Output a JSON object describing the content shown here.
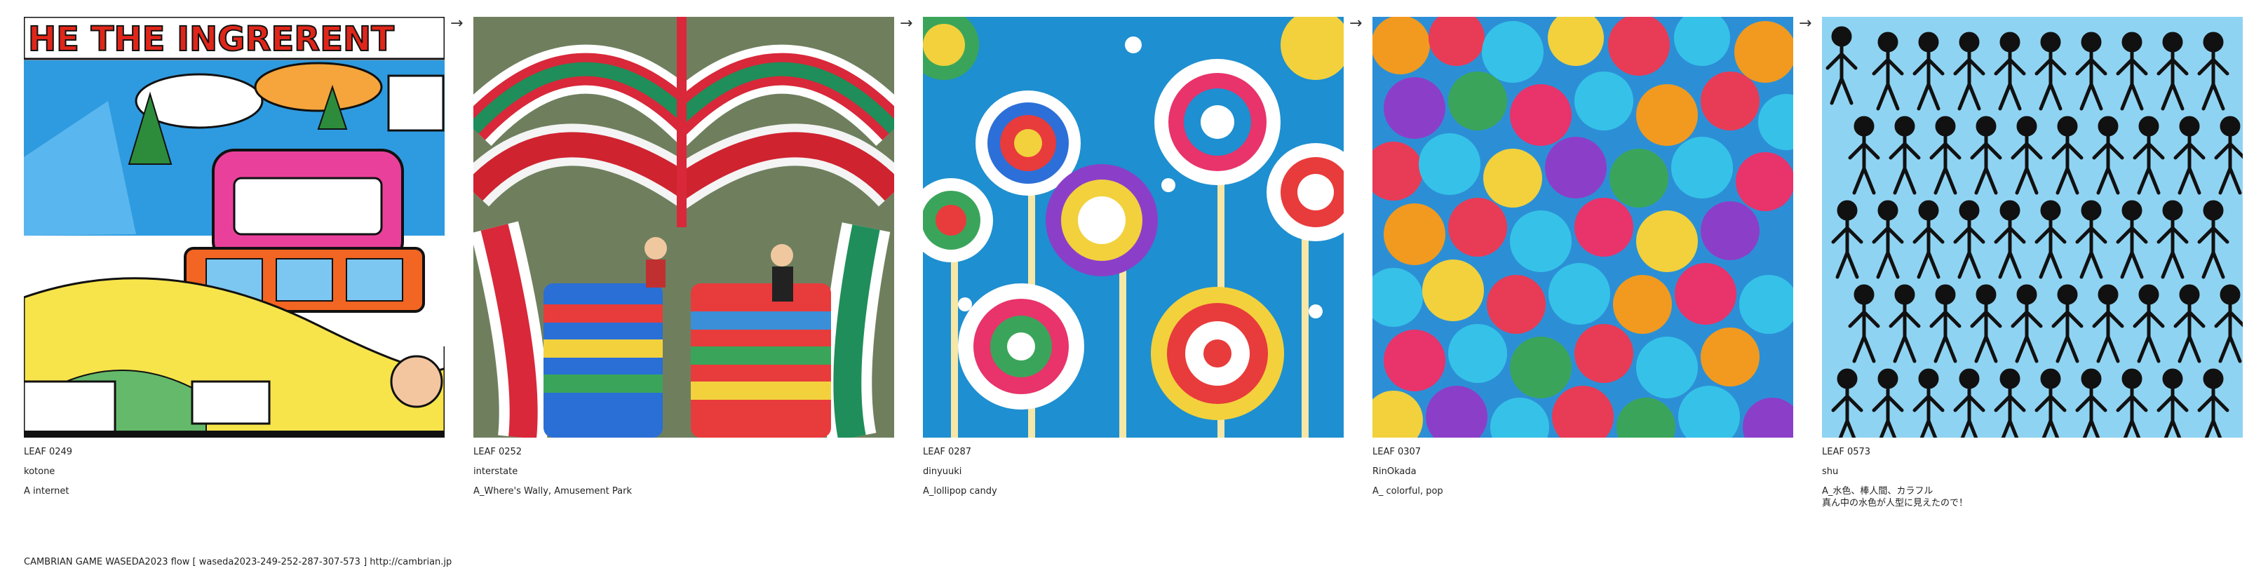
{
  "footer": {
    "text": "CAMBRIAN GAME  WASEDA2023  flow [ waseda2023-249-252-287-307-573 ]    http://cambrian.jp"
  },
  "flow": {
    "arrow_glyph": "→",
    "leaves": [
      {
        "id": "LEAF 0249",
        "author": "kotone",
        "prompt": "A internet",
        "image": "comic-style cartoon illustration with the headline text 'HE THE INGRERENT'"
      },
      {
        "id": "LEAF 0252",
        "author": "interstate",
        "prompt": "A_Where's   Wally, Amusement Park",
        "image": "striped red, green and white inflatable amusement park ride with people"
      },
      {
        "id": "LEAF 0287",
        "author": "dinyuuki",
        "prompt": "A_lollipop candy",
        "image": "swirled rainbow lollipops on a blue background"
      },
      {
        "id": "LEAF 0307",
        "author": "RinOkada",
        "prompt": "A_ colorful, pop",
        "image": "pile of colorful candy pieces and raspberries"
      },
      {
        "id": "LEAF 0573",
        "author": "shu",
        "prompt": "A_水色、棒人間、カラフル\n真ん中の水色が人型に見えたので！",
        "image": "stick figure people drawn on a light blue background"
      }
    ]
  }
}
